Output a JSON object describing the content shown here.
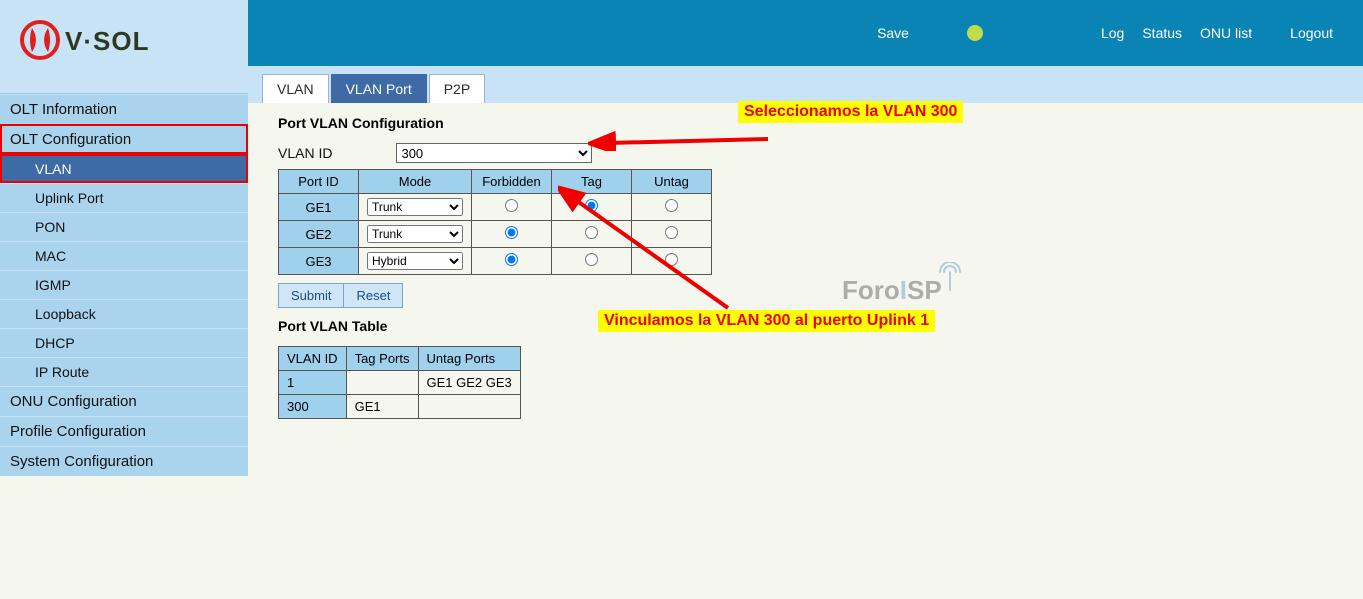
{
  "brand": {
    "name": "V·SOL"
  },
  "topbar": {
    "save": "Save",
    "log": "Log",
    "status": "Status",
    "onu_list": "ONU list",
    "logout": "Logout"
  },
  "sidebar": {
    "items": [
      {
        "label": "OLT Information",
        "level": 1
      },
      {
        "label": "OLT Configuration",
        "level": 1,
        "hl": true
      },
      {
        "label": "VLAN",
        "level": 2,
        "active": true,
        "hl": true
      },
      {
        "label": "Uplink Port",
        "level": 2
      },
      {
        "label": "PON",
        "level": 2
      },
      {
        "label": "MAC",
        "level": 2
      },
      {
        "label": "IGMP",
        "level": 2
      },
      {
        "label": "Loopback",
        "level": 2
      },
      {
        "label": "DHCP",
        "level": 2
      },
      {
        "label": "IP Route",
        "level": 2
      },
      {
        "label": "ONU Configuration",
        "level": 1
      },
      {
        "label": "Profile Configuration",
        "level": 1
      },
      {
        "label": "System Configuration",
        "level": 1
      }
    ]
  },
  "tabs": [
    {
      "label": "VLAN",
      "active": false
    },
    {
      "label": "VLAN Port",
      "active": true
    },
    {
      "label": "P2P",
      "active": false
    }
  ],
  "section1_title": "Port VLAN Configuration",
  "vlan_id_label": "VLAN ID",
  "vlan_id_value": "300",
  "cfg_headers": [
    "Port ID",
    "Mode",
    "Forbidden",
    "Tag",
    "Untag"
  ],
  "cfg_rows": [
    {
      "port": "GE1",
      "mode": "Trunk",
      "sel": "Tag"
    },
    {
      "port": "GE2",
      "mode": "Trunk",
      "sel": "Forbidden"
    },
    {
      "port": "GE3",
      "mode": "Hybrid",
      "sel": "Forbidden"
    }
  ],
  "buttons": {
    "submit": "Submit",
    "reset": "Reset"
  },
  "section2_title": "Port VLAN Table",
  "tbl_headers": [
    "VLAN ID",
    "Tag Ports",
    "Untag Ports"
  ],
  "tbl_rows": [
    {
      "id": "1",
      "tag": "",
      "untag": "GE1 GE2 GE3"
    },
    {
      "id": "300",
      "tag": "GE1",
      "untag": ""
    }
  ],
  "annotations": {
    "a1": "Seleccionamos la VLAN 300",
    "a2": "Vinculamos la VLAN 300 al puerto Uplink 1"
  },
  "watermark": {
    "t1": "Foro",
    "t2": "I",
    "t3": "SP"
  }
}
